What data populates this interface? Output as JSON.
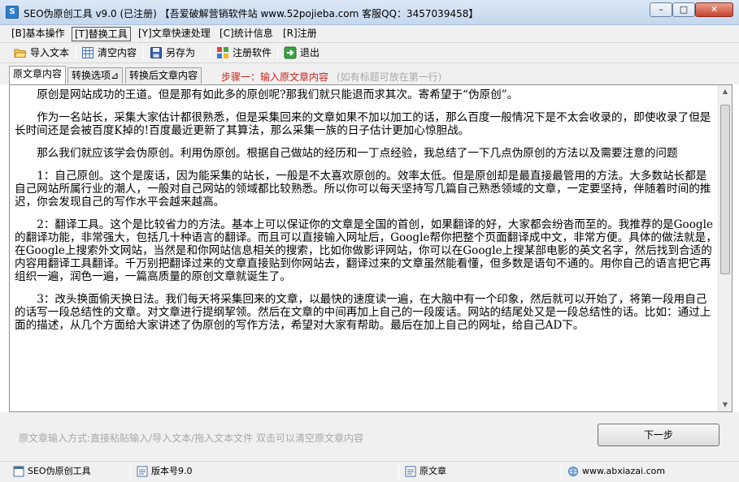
{
  "window": {
    "title": "SEO伪原创工具 v9.0 (已注册) 【吾爱破解营销软件站 www.52pojieba.com 客服QQ：3457039458】",
    "controls": {
      "minimize": "–",
      "maximize": "□",
      "close": "✕"
    }
  },
  "menu": [
    {
      "label": "[B]基本操作"
    },
    {
      "label": "[T]替换工具"
    },
    {
      "label": "[Y]文章快速处理"
    },
    {
      "label": "[C]统计信息"
    },
    {
      "label": "[R]注册"
    }
  ],
  "toolbar": {
    "import": "导入文本",
    "clear": "清空内容",
    "save_as": "另存为",
    "register": "注册软件",
    "exit": "退出"
  },
  "tabs": [
    {
      "label": "原文章内容"
    },
    {
      "label": "转换选项⊿"
    },
    {
      "label": "转换后文章内容"
    }
  ],
  "step_text": "步骤一：输入原文章内容",
  "title_hint": "(如有标题可放在第一行)",
  "article": [
    "原创是网站成功的王道。但是那有如此多的原创呢?那我们就只能退而求其次。寄希望于“伪原创”。",
    "作为一名站长，采集大家估计都很熟悉，但是采集回来的文章如果不加以加工的话，那么百度一般情况下是不太会收录的，即使收录了但是长时间还是会被百度K掉的!百度最近更新了其算法，那么采集一族的日子估计更加心惊胆战。",
    "那么我们就应该学会伪原创。利用伪原创。根据自己做站的经历和一丁点经验，我总结了一下几点伪原创的方法以及需要注意的问题",
    "1：自己原创。这个是废话，因为能采集的站长，一般是不太喜欢原创的。效率太低。但是原创却是最直接最管用的方法。大多数站长都是自己网站所属行业的潮人，一般对自己网站的领域都比较熟悉。所以你可以每天坚持写几篇自己熟悉领域的文章，一定要坚持，伴随着时间的推迟，你会发现自己的写作水平会越来越高。",
    "2：翻译工具。这个是比较省力的方法。基本上可以保证你的文章是全国的首创，如果翻译的好，大家都会纷沓而至的。我推荐的是Google的翻译功能，非常强大，包括几十种语言的翻译。而且可以直接输入网址后，Google帮你把整个页面翻译成中文，非常方便。具体的做法就是，在Google上搜索外文网站，当然是和你网站信息相关的搜索，比如你做影评网站，你可以在Google上搜某部电影的英文名字，然后找到合适的内容用翻译工具翻译。千万别把翻译过来的文章直接贴到你网站去，翻译过来的文章虽然能看懂，但多数是语句不通的。用你自己的语言把它再组织一遍，润色一遍，一篇高质量的原创文章就诞生了。",
    "3：改头换面偷天换日法。我们每天将采集回来的文章，以最快的速度读一遍，在大脑中有一个印象，然后就可以开始了，将第一段用自己的话写一段总结性的文章。对文章进行提纲挈领。然后在文章的中间再加上自己的一段废话。网站的结尾处又是一段总结性的话。比如：通过上面的描述，从几个方面给大家讲述了伪原创的写作方法，希望对大家有帮助。最后在加上自己的网址，给自己AD下。"
  ],
  "input_hint": "原文章输入方式:直接粘贴输入/导入文本/拖入文本文件 双击可以清空原文章内容",
  "next_button": "下一步",
  "status": {
    "app": "SEO伪原创工具",
    "version": "版本号9.0",
    "mode": "原文章",
    "site": "www.abxiazai.com"
  }
}
